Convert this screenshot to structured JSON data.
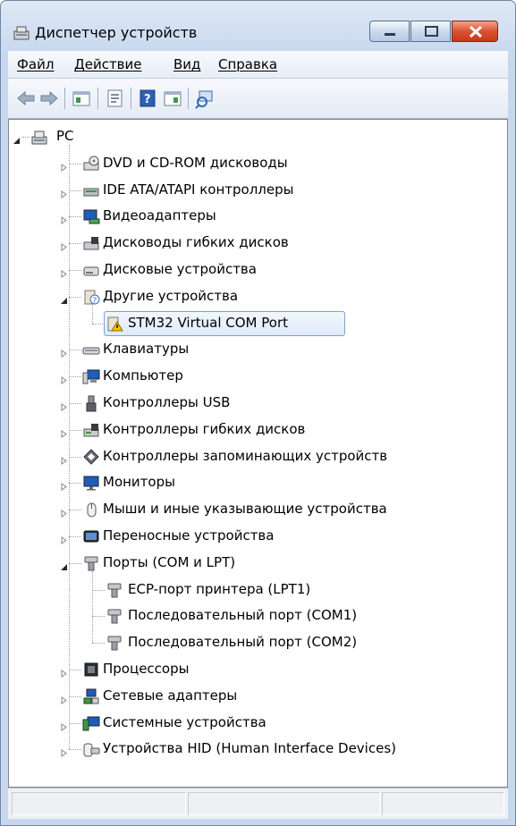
{
  "window": {
    "title": "Диспетчер устройств"
  },
  "menu": {
    "items": [
      "Файл",
      "Действие",
      "Вид",
      "Справка"
    ]
  },
  "toolbar": {
    "buttons": [
      "back-icon",
      "forward-icon",
      "show-hide-tree-icon",
      "properties-icon",
      "help-icon",
      "action-pane-icon",
      "scan-hardware-icon"
    ]
  },
  "tree": {
    "root": "PC",
    "categories": [
      {
        "label": "DVD и CD-ROM дисководы",
        "icon": "dvd-drive-icon",
        "expanded": false
      },
      {
        "label": "IDE ATA/ATAPI контроллеры",
        "icon": "ide-controller-icon",
        "expanded": false
      },
      {
        "label": "Видеоадаптеры",
        "icon": "display-adapter-icon",
        "expanded": false
      },
      {
        "label": "Дисководы гибких дисков",
        "icon": "floppy-drive-icon",
        "expanded": false
      },
      {
        "label": "Дисковые устройства",
        "icon": "disk-drive-icon",
        "expanded": false
      },
      {
        "label": "Другие устройства",
        "icon": "unknown-device-icon",
        "expanded": true,
        "children": [
          {
            "label": "STM32 Virtual COM Port",
            "icon": "warning-device-icon",
            "selected": true
          }
        ]
      },
      {
        "label": "Клавиатуры",
        "icon": "keyboard-icon",
        "expanded": false
      },
      {
        "label": "Компьютер",
        "icon": "computer-icon",
        "expanded": false
      },
      {
        "label": "Контроллеры USB",
        "icon": "usb-icon",
        "expanded": false
      },
      {
        "label": "Контроллеры гибких дисков",
        "icon": "floppy-controller-icon",
        "expanded": false
      },
      {
        "label": "Контроллеры запоминающих устройств",
        "icon": "storage-controller-icon",
        "expanded": false
      },
      {
        "label": "Мониторы",
        "icon": "monitor-icon",
        "expanded": false
      },
      {
        "label": "Мыши и иные указывающие устройства",
        "icon": "mouse-icon",
        "expanded": false
      },
      {
        "label": "Переносные устройства",
        "icon": "portable-device-icon",
        "expanded": false
      },
      {
        "label": "Порты (COM и LPT)",
        "icon": "port-icon",
        "expanded": true,
        "children": [
          {
            "label": "ECP-порт принтера (LPT1)",
            "icon": "port-icon"
          },
          {
            "label": "Последовательный порт (COM1)",
            "icon": "port-icon"
          },
          {
            "label": "Последовательный порт (COM2)",
            "icon": "port-icon"
          }
        ]
      },
      {
        "label": "Процессоры",
        "icon": "processor-icon",
        "expanded": false
      },
      {
        "label": "Сетевые адаптеры",
        "icon": "network-adapter-icon",
        "expanded": false
      },
      {
        "label": "Системные устройства",
        "icon": "system-device-icon",
        "expanded": false
      },
      {
        "label": "Устройства HID (Human Interface Devices)",
        "icon": "hid-device-icon",
        "expanded": false
      }
    ]
  },
  "statusbar": {
    "panes": [
      "",
      "",
      ""
    ]
  }
}
